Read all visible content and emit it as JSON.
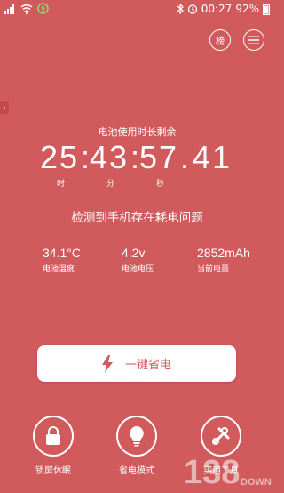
{
  "status_bar": {
    "time": "00:27",
    "battery_percent": "92%",
    "icons": [
      "signal-icon",
      "wifi-icon",
      "badge-icon",
      "bluetooth-icon",
      "alarm-icon",
      "battery-icon"
    ]
  },
  "header": {
    "left_button_label": "榜",
    "right_button_icon": "menu-icon"
  },
  "battery_remaining": {
    "title": "电池使用时长剩余",
    "hours": "25",
    "minutes": "43",
    "seconds": "57",
    "fraction": "41",
    "unit_hour": "时",
    "unit_minute": "分",
    "unit_second": "秒"
  },
  "warning_text": "检测到手机存在耗电问题",
  "stats": [
    {
      "value": "34.1°C",
      "label": "电池温度"
    },
    {
      "value": "4.2v",
      "label": "电池电压"
    },
    {
      "value": "2852mAh",
      "label": "当前电量"
    }
  ],
  "one_key_save": {
    "label": "一键省电",
    "icon": "lightning-icon"
  },
  "bottom_tools": [
    {
      "label": "锁屏休眠",
      "icon": "lock-icon"
    },
    {
      "label": "省电模式",
      "icon": "lightbulb-icon"
    },
    {
      "label": "实用工具",
      "icon": "wrench-icon"
    }
  ],
  "watermark": {
    "number": "138",
    "text": "DOWN"
  },
  "colors": {
    "background": "#d05a5c",
    "foreground": "#ffffff"
  }
}
